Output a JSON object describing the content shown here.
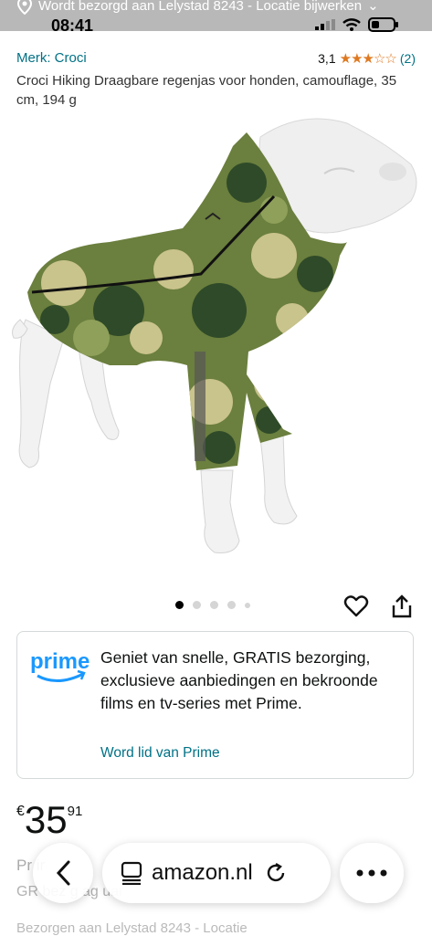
{
  "status_bar": {
    "delivery_banner": "Wordt bezorgd aan Lelystad 8243 - Locatie bijwerken",
    "time": "08:41"
  },
  "product": {
    "brand": "Merk: Croci",
    "rating_value": "3,1",
    "rating_stars": 3,
    "review_count": "(2)",
    "title": "Croci Hiking Draagbare regenjas voor honden, camouflage, 35 cm, 194 g",
    "image_count": 5,
    "active_image": 0
  },
  "prime": {
    "logo_text": "prime",
    "message": "Geniet van snelle, GRATIS bezorging, exclusieve aanbiedingen en bekroonde films en tv-series met Prime.",
    "link": "Word lid van Prime"
  },
  "price": {
    "currency": "€",
    "whole": "35",
    "fraction": "91"
  },
  "underlying": {
    "line1": "Pr        ir",
    "line2": "GR       bez          g          ag          uar",
    "line3": "Bezorgen aan Lelystad 8243 - Locatie"
  },
  "browser": {
    "url": "amazon.nl"
  },
  "colors": {
    "link": "#007185",
    "star": "#de7921",
    "prime_blue": "#1a98ff"
  }
}
